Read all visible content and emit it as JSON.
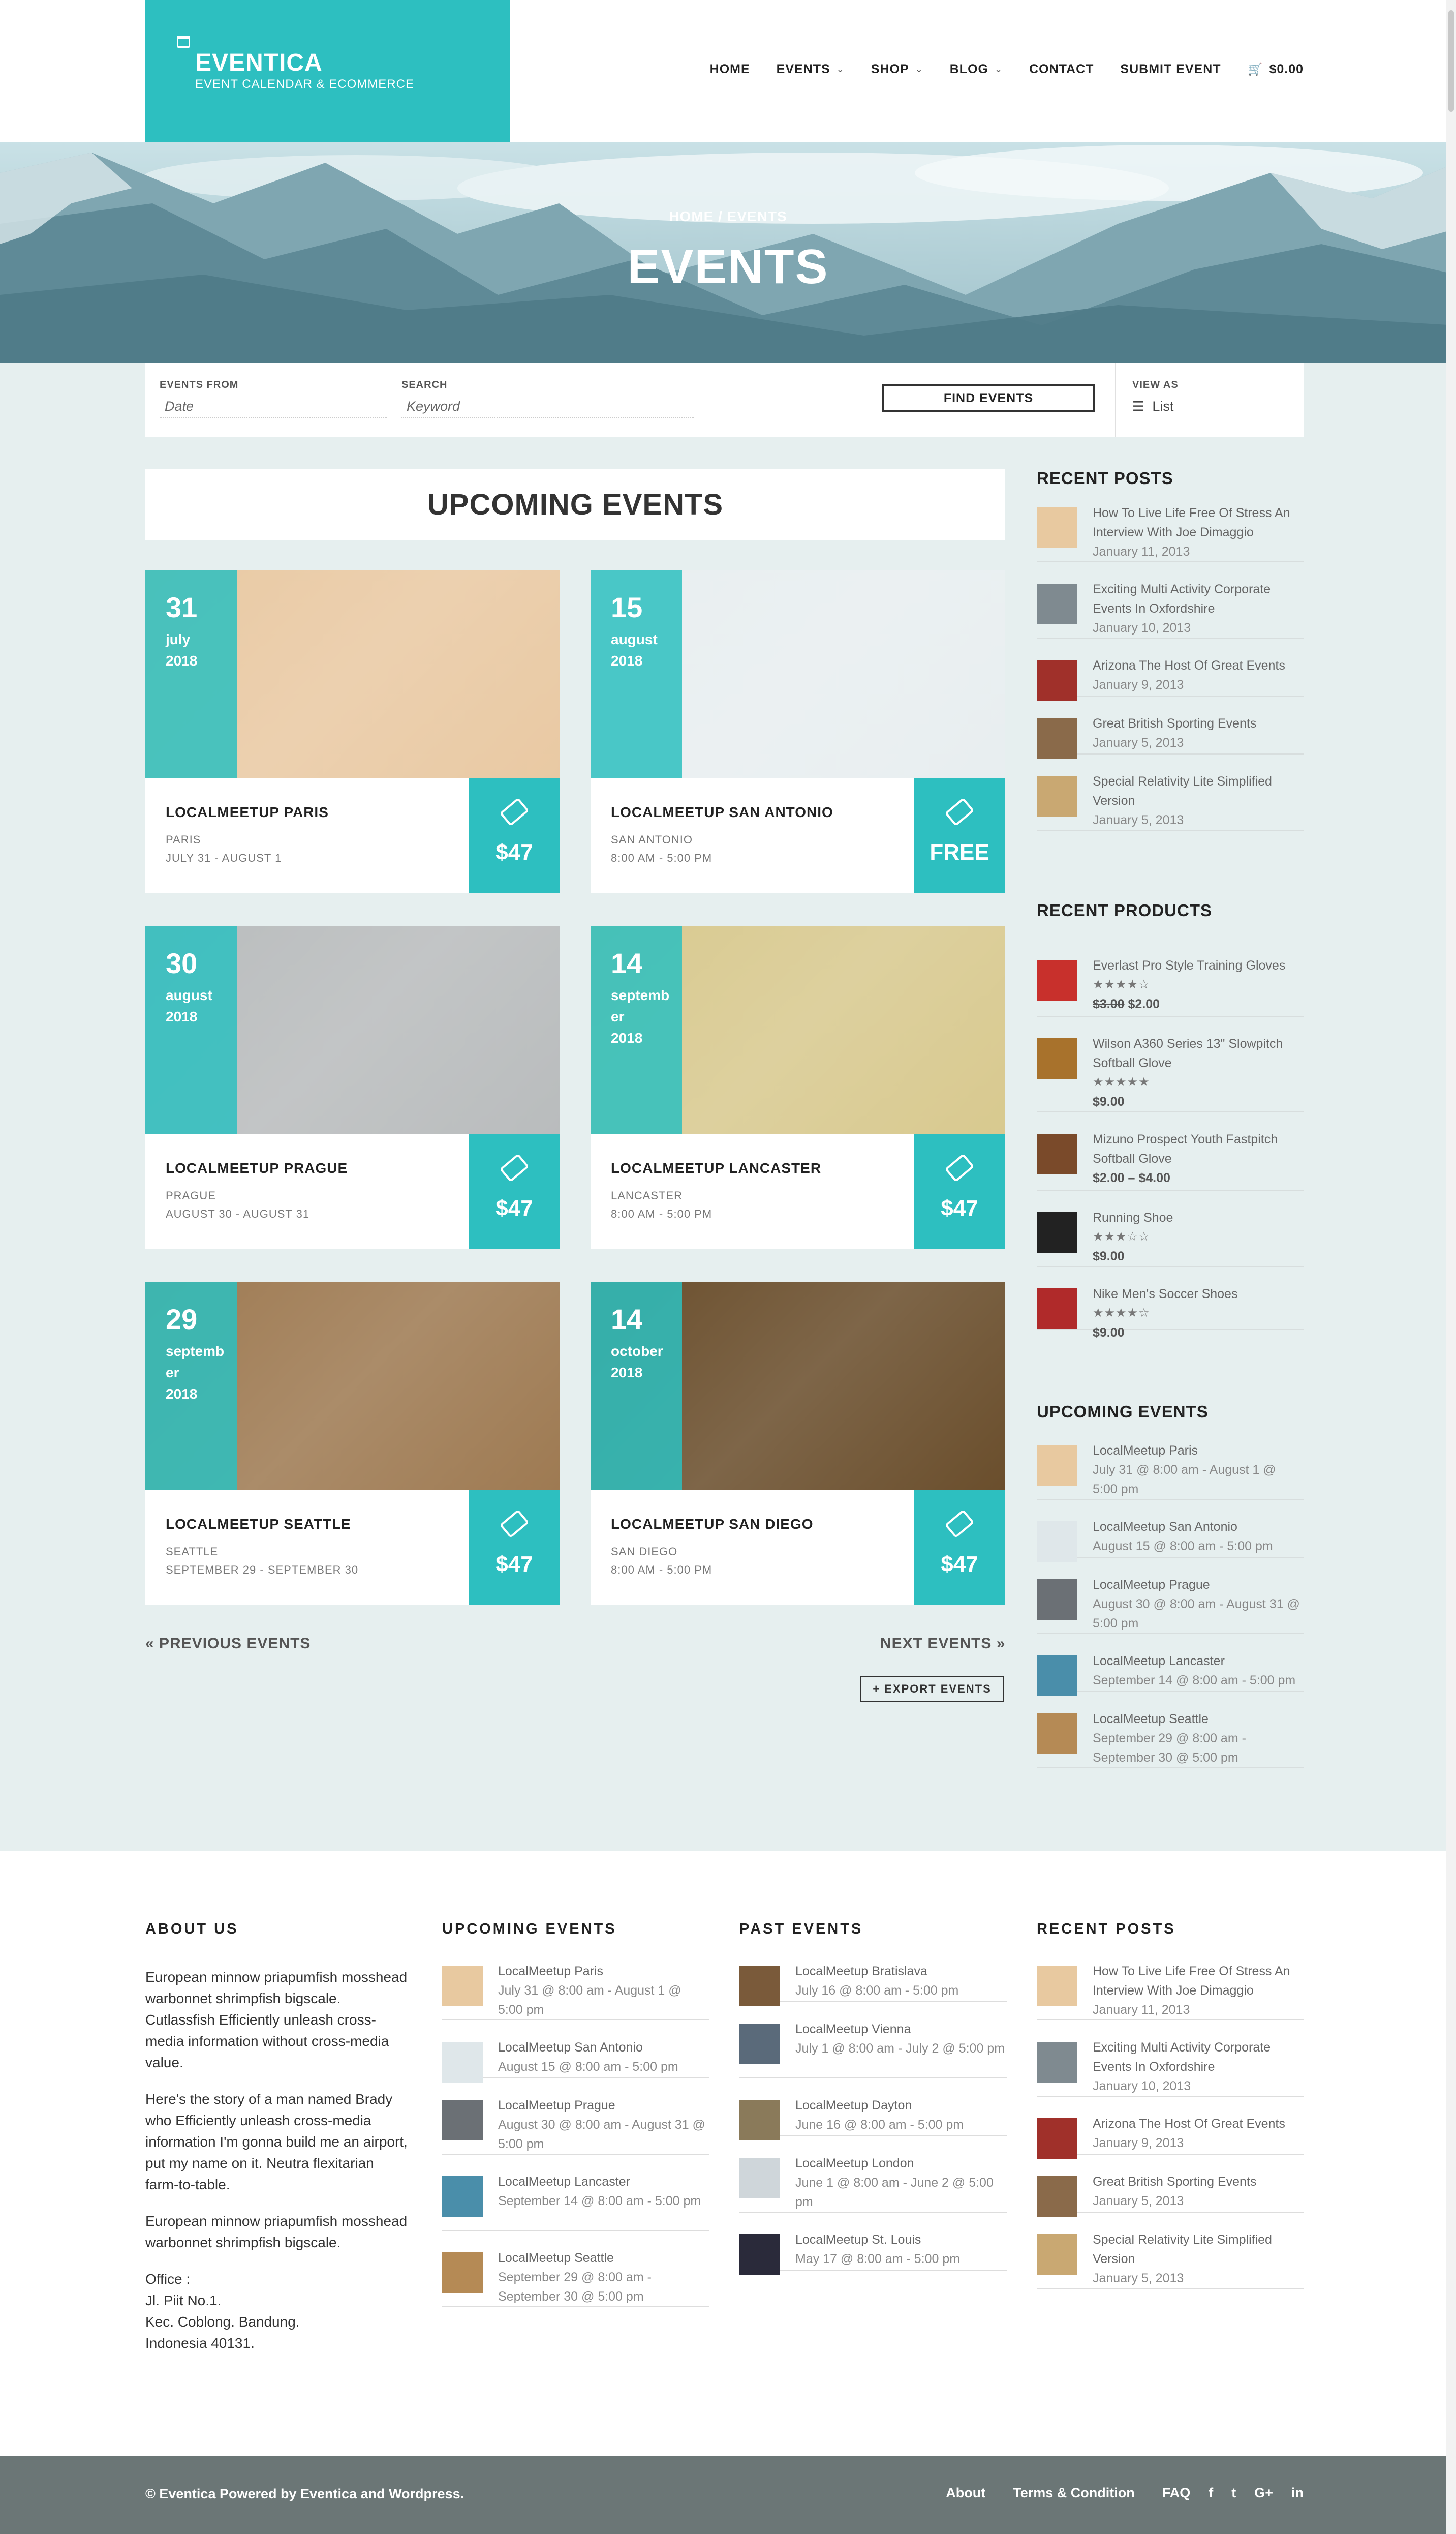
{
  "brand": {
    "name": "EVENTICA",
    "tagline": "EVENT CALENDAR & ECOMMERCE"
  },
  "nav": [
    {
      "label": "HOME",
      "dropdown": false
    },
    {
      "label": "EVENTS",
      "dropdown": true
    },
    {
      "label": "SHOP",
      "dropdown": true
    },
    {
      "label": "BLOG",
      "dropdown": true
    },
    {
      "label": "CONTACT",
      "dropdown": false
    },
    {
      "label": "SUBMIT EVENT",
      "dropdown": false
    },
    {
      "label": "$0.00",
      "dropdown": false,
      "icon": "cart-icon"
    }
  ],
  "hero": {
    "breadcrumb": "HOME / EVENTS",
    "title": "EVENTS"
  },
  "filter": {
    "from_label": "EVENTS FROM",
    "from_placeholder": "Date",
    "search_label": "SEARCH",
    "search_placeholder": "Keyword",
    "find_button": "FIND EVENTS",
    "view_label": "VIEW AS",
    "view_value": "List"
  },
  "upcoming_heading": "UPCOMING EVENTS",
  "events": [
    {
      "day": "31",
      "month": "july",
      "year": "2018",
      "title": "LOCALMEETUP PARIS",
      "loc": "PARIS",
      "time": "JULY 31 - AUGUST 1",
      "price": "$47",
      "img": "#e9c9a3"
    },
    {
      "day": "15",
      "month": "august",
      "year": "2018",
      "title": "LOCALMEETUP SAN ANTONIO",
      "loc": "SAN ANTONIO",
      "time": "8:00 AM - 5:00 PM",
      "price": "FREE",
      "img": "#e8eef0"
    },
    {
      "day": "30",
      "month": "august",
      "year": "2018",
      "title": "LOCALMEETUP PRAGUE",
      "loc": "PRAGUE",
      "time": "AUGUST 30 - AUGUST 31",
      "price": "$47",
      "img": "#b9bcbd"
    },
    {
      "day": "14",
      "month": "september",
      "year": "2018",
      "title": "LOCALMEETUP LANCASTER",
      "loc": "LANCASTER",
      "time": "8:00 AM - 5:00 PM",
      "price": "$47",
      "img": "#d8c98f"
    },
    {
      "day": "29",
      "month": "september",
      "year": "2018",
      "title": "LOCALMEETUP SEATTLE",
      "loc": "SEATTLE",
      "time": "SEPTEMBER 29 - SEPTEMBER 30",
      "price": "$47",
      "img": "#9e7a52"
    },
    {
      "day": "14",
      "month": "october",
      "year": "2018",
      "title": "LOCALMEETUP SAN DIEGO",
      "loc": "SAN DIEGO",
      "time": "8:00 AM - 5:00 PM",
      "price": "$47",
      "img": "#6a4e2c"
    }
  ],
  "pagination": {
    "prev": "« PREVIOUS EVENTS",
    "next": "NEXT EVENTS »",
    "export": "+ EXPORT EVENTS"
  },
  "sidebar": {
    "recent_posts_title": "RECENT POSTS",
    "recent_posts": [
      {
        "title": "How To Live Life Free Of Stress An Interview With Joe Dimaggio",
        "date": "January 11, 2013",
        "thumb": "#e8c9a0"
      },
      {
        "title": "Exciting Multi Activity Corporate Events In Oxfordshire",
        "date": "January 10, 2013",
        "thumb": "#7f8a90"
      },
      {
        "title": "Arizona The Host Of Great Events",
        "date": "January 9, 2013",
        "thumb": "#a0302a"
      },
      {
        "title": "Great British Sporting Events",
        "date": "January 5, 2013",
        "thumb": "#8a6a4a"
      },
      {
        "title": "Special Relativity Lite Simplified Version",
        "date": "January 5, 2013",
        "thumb": "#c9a872"
      }
    ],
    "recent_products_title": "RECENT PRODUCTS",
    "recent_products": [
      {
        "name": "Everlast Pro Style Training Gloves",
        "stars": "★★★★☆",
        "old": "$3.00",
        "price": "$2.00",
        "thumb": "#c8302c"
      },
      {
        "name": "Wilson A360 Series 13\" Slowpitch Softball Glove",
        "stars": "★★★★★",
        "old": "",
        "price": "$9.00",
        "thumb": "#a8722c"
      },
      {
        "name": "Mizuno Prospect Youth Fastpitch Softball Glove",
        "stars": "",
        "old": "",
        "price": "$2.00 – $4.00",
        "thumb": "#7a4a2a"
      },
      {
        "name": "Running Shoe",
        "stars": "★★★☆☆",
        "old": "",
        "price": "$9.00",
        "thumb": "#222222"
      },
      {
        "name": "Nike Men's Soccer Shoes",
        "stars": "★★★★☆",
        "old": "",
        "price": "$9.00",
        "thumb": "#b02a2a"
      }
    ],
    "upcoming_title": "UPCOMING EVENTS",
    "upcoming": [
      {
        "name": "LocalMeetup Paris",
        "when": "July 31 @ 8:00 am - August 1 @ 5:00 pm",
        "thumb": "#e8c9a0"
      },
      {
        "name": "LocalMeetup San Antonio",
        "when": "August 15 @ 8:00 am - 5:00 pm",
        "thumb": "#dfe7ea"
      },
      {
        "name": "LocalMeetup Prague",
        "when": "August 30 @ 8:00 am - August 31 @ 5:00 pm",
        "thumb": "#6b7075"
      },
      {
        "name": "LocalMeetup Lancaster",
        "when": "September 14 @ 8:00 am - 5:00 pm",
        "thumb": "#4a8eaa"
      },
      {
        "name": "LocalMeetup Seattle",
        "when": "September 29 @ 8:00 am - September 30 @ 5:00 pm",
        "thumb": "#b58a55"
      }
    ]
  },
  "footer": {
    "about_title": "ABOUT US",
    "about_paragraphs": [
      "European minnow priapumfish mosshead warbonnet shrimpfish bigscale. Cutlassfish Efficiently unleash cross-media information without cross-media value.",
      "Here's the story of a man named Brady who Efficiently unleash cross-media information I'm gonna build me an airport, put my name on it. Neutra flexitarian farm-to-table.",
      "European minnow priapumfish mosshead warbonnet shrimpfish bigscale."
    ],
    "office_label": "Office :",
    "office_lines": [
      "Jl. Piit No.1.",
      "Kec. Coblong. Bandung.",
      "Indonesia 40131."
    ],
    "upcoming_title": "UPCOMING EVENTS",
    "upcoming": [
      {
        "name": "LocalMeetup Paris",
        "when": "July 31 @ 8:00 am - August 1 @ 5:00 pm",
        "thumb": "#e8c9a0"
      },
      {
        "name": "LocalMeetup San Antonio",
        "when": "August 15 @ 8:00 am - 5:00 pm",
        "thumb": "#dfe7ea"
      },
      {
        "name": "LocalMeetup Prague",
        "when": "August 30 @ 8:00 am - August 31 @ 5:00 pm",
        "thumb": "#6b7075"
      },
      {
        "name": "LocalMeetup Lancaster",
        "when": "September 14 @ 8:00 am - 5:00 pm",
        "thumb": "#4a8eaa"
      },
      {
        "name": "LocalMeetup Seattle",
        "when": "September 29 @ 8:00 am - September 30 @ 5:00 pm",
        "thumb": "#b58a55"
      }
    ],
    "past_title": "PAST EVENTS",
    "past": [
      {
        "name": "LocalMeetup Bratislava",
        "when": "July 16 @ 8:00 am - 5:00 pm",
        "thumb": "#7a5a3a"
      },
      {
        "name": "LocalMeetup Vienna",
        "when": "July 1 @ 8:00 am - July 2 @ 5:00 pm",
        "thumb": "#5a6a7a"
      },
      {
        "name": "LocalMeetup Dayton",
        "when": "June 16 @ 8:00 am - 5:00 pm",
        "thumb": "#8a7a5a"
      },
      {
        "name": "LocalMeetup London",
        "when": "June 1 @ 8:00 am - June 2 @ 5:00 pm",
        "thumb": "#cfd6da"
      },
      {
        "name": "LocalMeetup St. Louis",
        "when": "May 17 @ 8:00 am - 5:00 pm",
        "thumb": "#2a2a3a"
      }
    ],
    "posts_title": "RECENT POSTS",
    "posts": [
      {
        "title": "How To Live Life Free Of Stress An Interview With Joe Dimaggio",
        "date": "January 11, 2013",
        "thumb": "#e8c9a0"
      },
      {
        "title": "Exciting Multi Activity Corporate Events In Oxfordshire",
        "date": "January 10, 2013",
        "thumb": "#7f8a90"
      },
      {
        "title": "Arizona The Host Of Great Events",
        "date": "January 9, 2013",
        "thumb": "#a0302a"
      },
      {
        "title": "Great British Sporting Events",
        "date": "January 5, 2013",
        "thumb": "#8a6a4a"
      },
      {
        "title": "Special Relativity Lite Simplified Version",
        "date": "January 5, 2013",
        "thumb": "#c9a872"
      }
    ]
  },
  "bottom": {
    "copyright": "© Eventica Powered by Eventica and Wordpress.",
    "links": [
      "About",
      "Terms & Condition",
      "FAQ"
    ],
    "social": [
      "f",
      "t",
      "G+",
      "in"
    ]
  },
  "colors": {
    "accent": "#2dbfc0",
    "page_bg": "#e6efef",
    "footer_bar": "#6b7676"
  }
}
